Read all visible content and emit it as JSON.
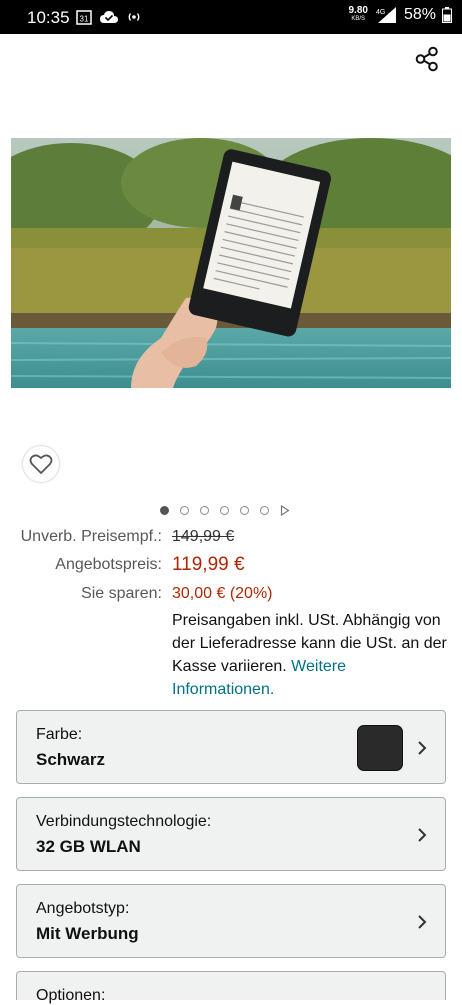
{
  "status": {
    "time": "10:35",
    "calendar_day": "31",
    "speed_value": "9.80",
    "speed_unit": "KB/S",
    "network": "4G",
    "battery": "58%"
  },
  "pricing": {
    "list_label": "Unverb. Preisempf.:",
    "list_price": "149,99 €",
    "offer_label": "Angebotspreis:",
    "offer_price": "119,99 €",
    "savings_label": "Sie sparen:",
    "savings_value": "30,00 € (20%)",
    "note_text": "Preisangaben inkl. USt. Abhängig von der Lieferadresse kann die USt. an der Kasse variieren.",
    "note_link": "Weitere Informationen."
  },
  "colors": {
    "price_red": "#b12704",
    "link_teal": "#007185"
  },
  "carousel": {
    "dot_count": 6,
    "active_index": 0
  },
  "variants": [
    {
      "label": "Farbe:",
      "value": "Schwarz"
    },
    {
      "label": "Verbindungstechnologie:",
      "value": "32 GB WLAN"
    },
    {
      "label": "Angebotstyp:",
      "value": "Mit Werbung"
    },
    {
      "label": "Optionen:",
      "value": ""
    }
  ],
  "icons": [
    "share-icon",
    "heart-icon",
    "chevron-right-icon",
    "play-icon"
  ]
}
